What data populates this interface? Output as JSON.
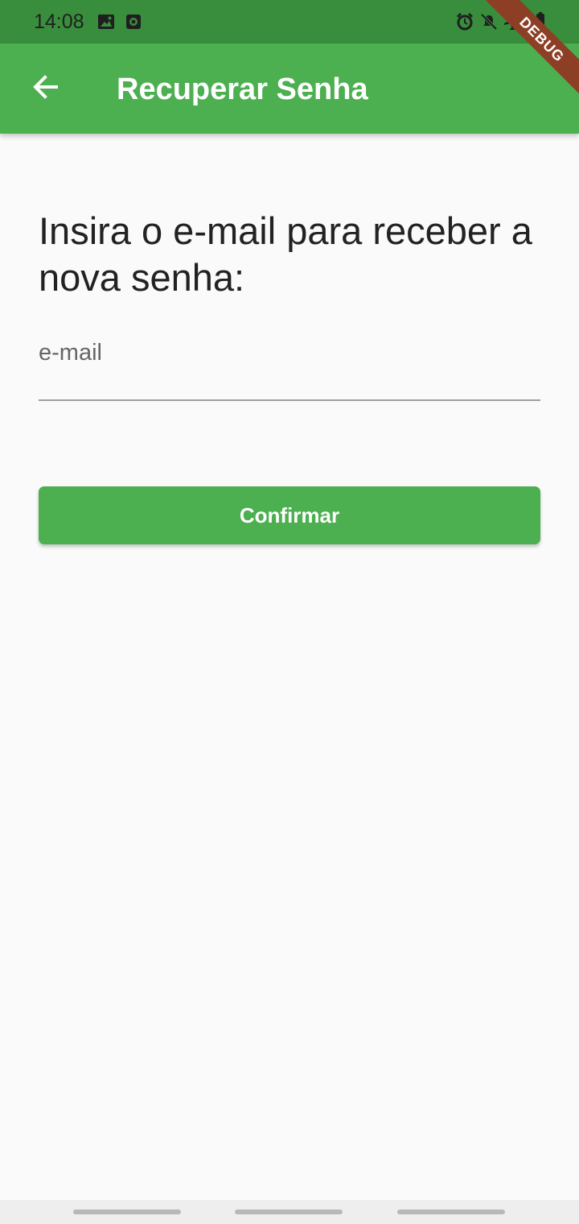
{
  "status_bar": {
    "time": "14:08",
    "left_icons": [
      "image-icon",
      "screen-record-icon"
    ],
    "right_icons": [
      "alarm-icon",
      "muted-icon",
      "airplane-icon",
      "battery-icon"
    ]
  },
  "app_bar": {
    "title": "Recuperar Senha",
    "back_icon": "arrow-left-icon",
    "background_color": "#4caf50"
  },
  "debug_banner": {
    "label": "DEBUG"
  },
  "main": {
    "instruction": "Insira o e-mail para receber a nova senha:",
    "email_field": {
      "value": "",
      "placeholder": "e-mail"
    },
    "confirm_button": {
      "label": "Confirmar"
    }
  },
  "colors": {
    "primary": "#4caf50",
    "status_bar": "#388e3c",
    "background": "#fafafa",
    "debug": "#8d3f26"
  }
}
